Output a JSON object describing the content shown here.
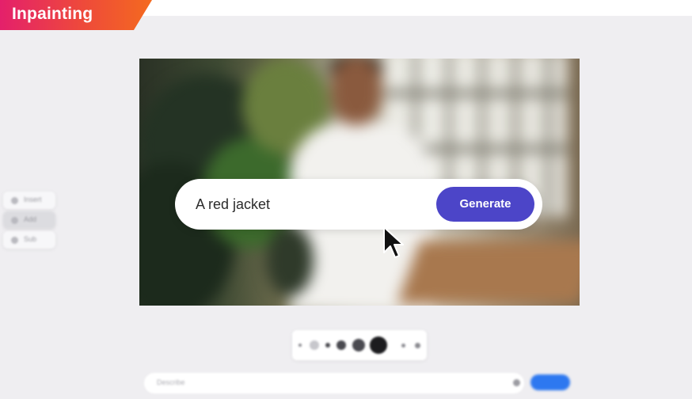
{
  "badge": {
    "label": "Inpainting"
  },
  "left_panel": {
    "items": [
      {
        "label": "Insert",
        "icon": "brush-icon"
      },
      {
        "label": "Add",
        "icon": "plus-icon"
      },
      {
        "label": "Sub",
        "icon": "eraser-icon"
      }
    ]
  },
  "prompt": {
    "value": "A red jacket",
    "button_label": "Generate"
  },
  "brush_toolbar": {
    "sizes": [
      "xs",
      "s",
      "m",
      "l",
      "xl"
    ]
  },
  "bottom_bar": {
    "placeholder": "Describe"
  },
  "colors": {
    "badge_start": "#e4206b",
    "badge_end": "#f46a1f",
    "generate_button": "#4c45c8",
    "submit_button": "#2d78f0"
  }
}
